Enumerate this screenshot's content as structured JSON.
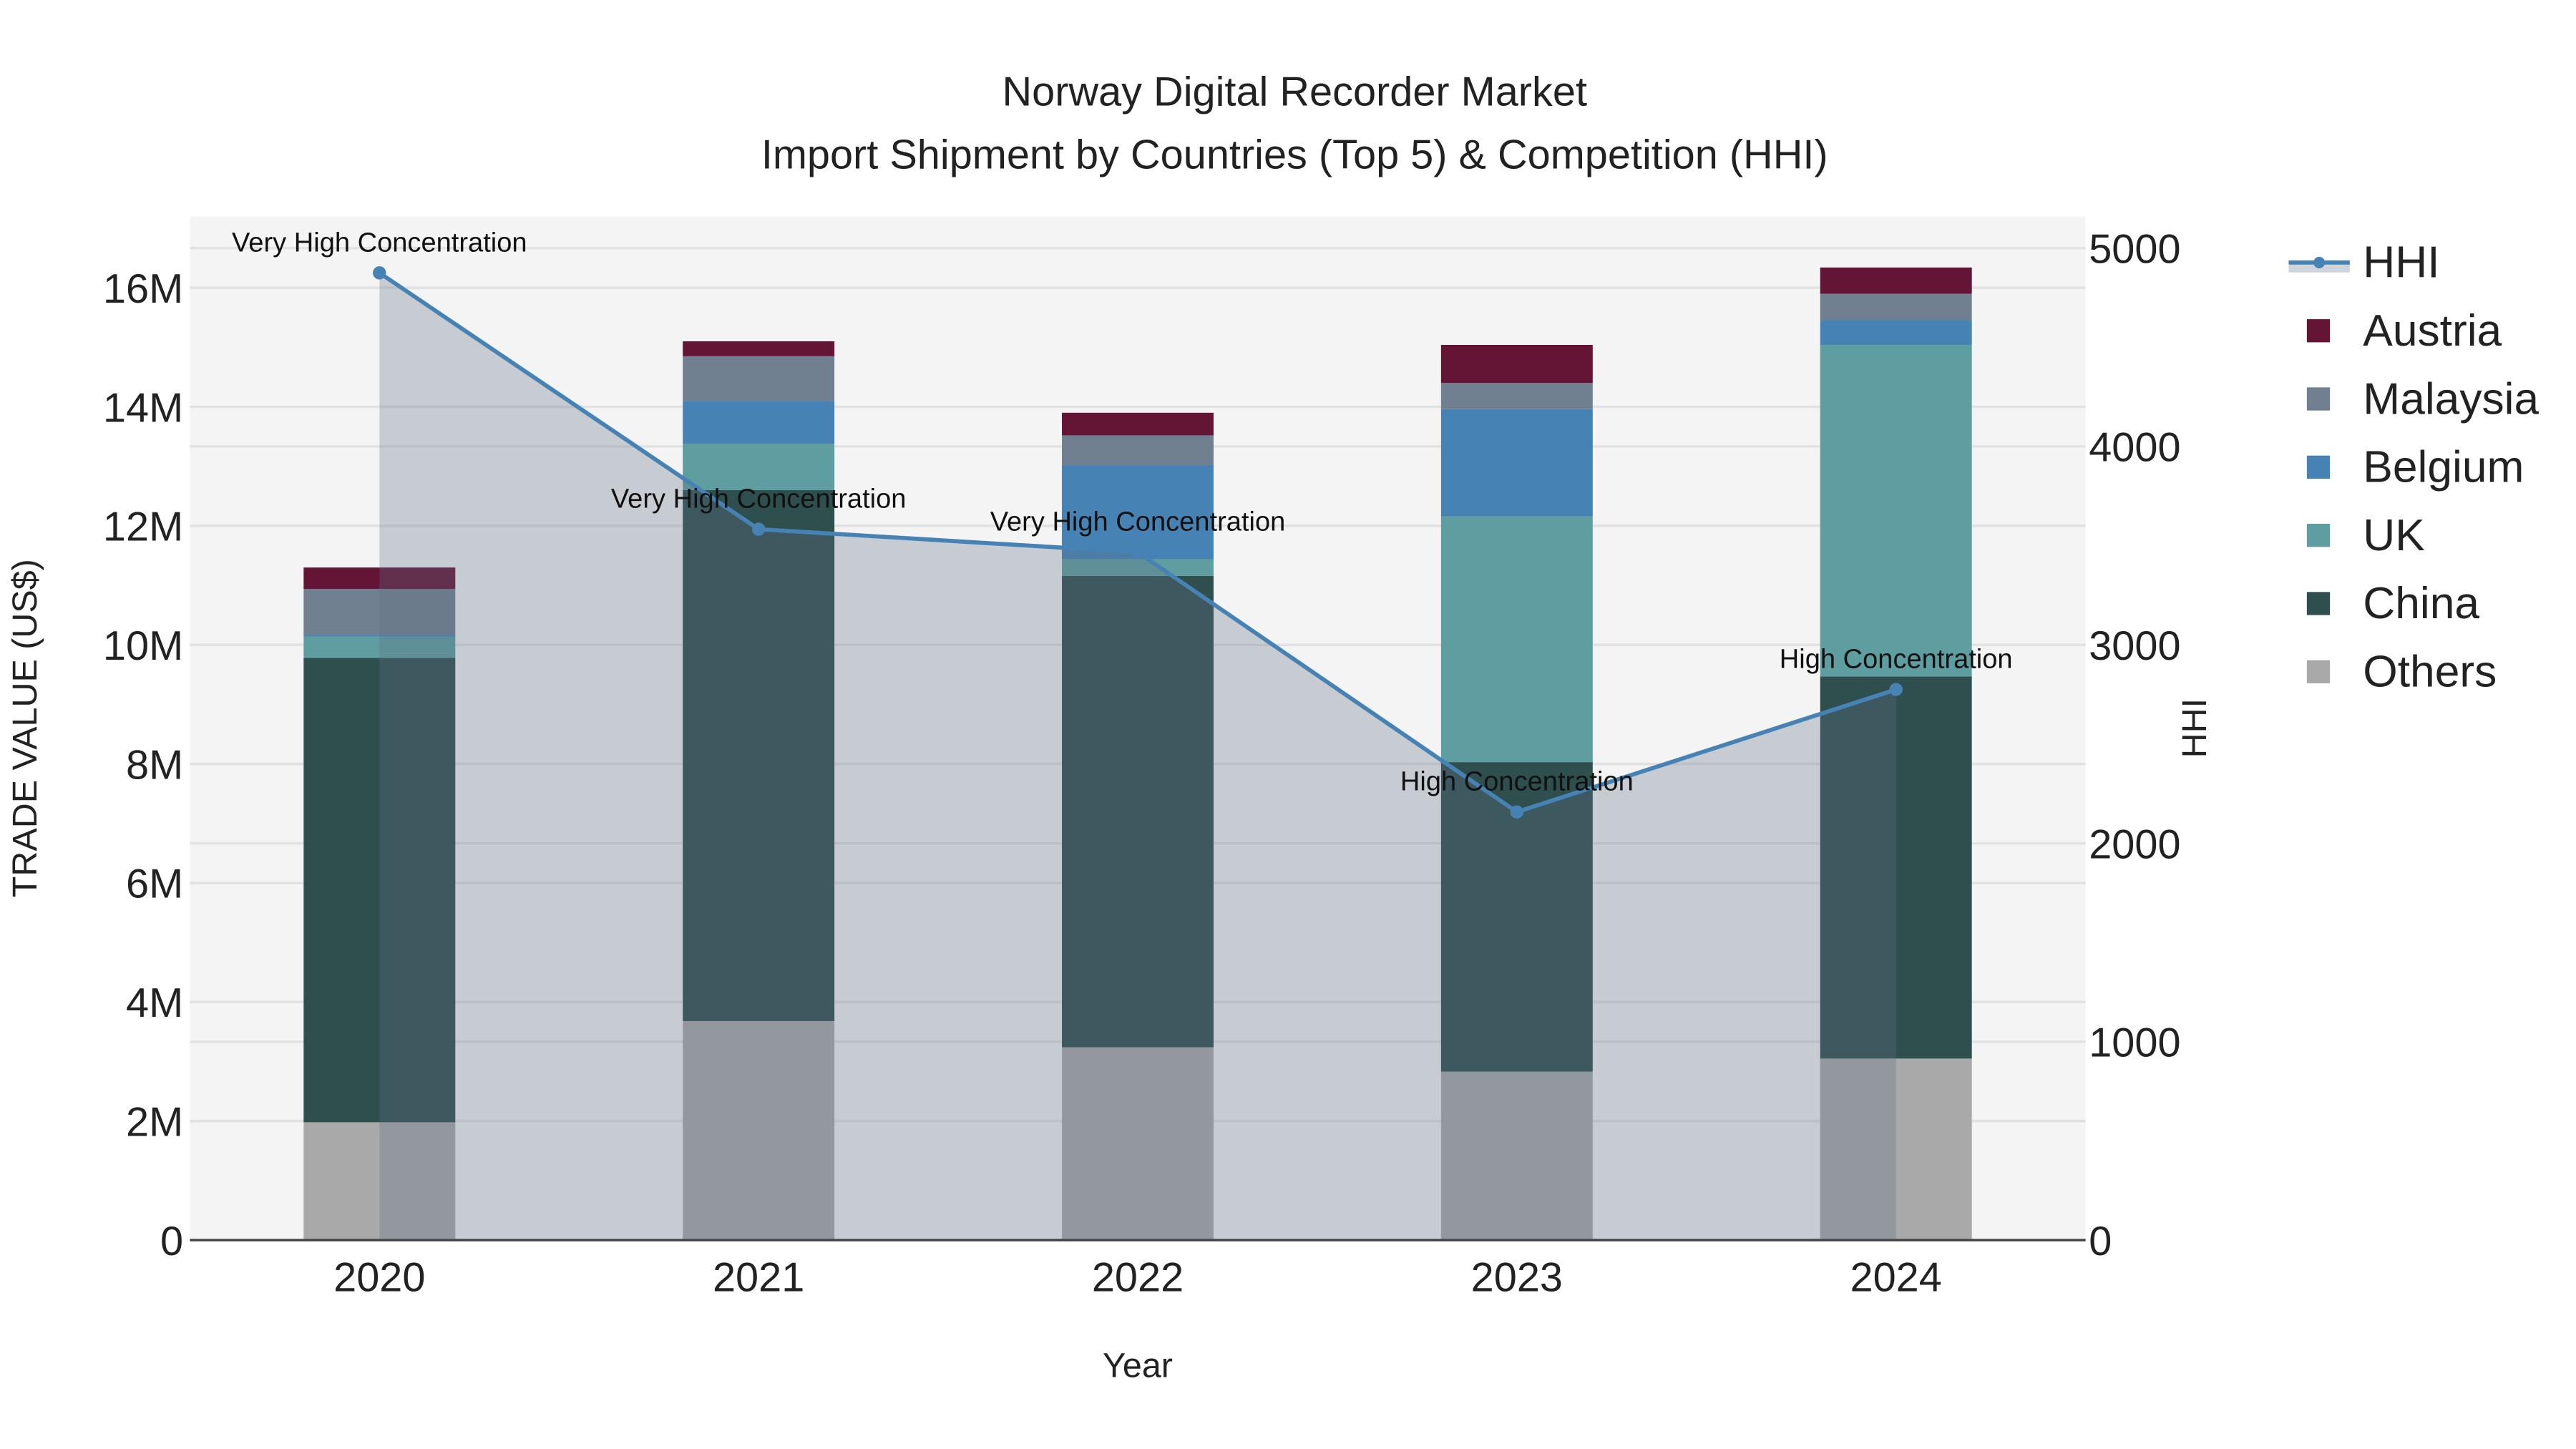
{
  "chart_data": {
    "type": "bar",
    "title_line1": "Norway Digital Recorder Market",
    "title_line2": "Import Shipment by Countries (Top 5) & Competition (HHI)",
    "xlabel": "Year",
    "ylabel": "TRADE VALUE (US$)",
    "y2label": "HHI",
    "categories": [
      "2020",
      "2021",
      "2022",
      "2023",
      "2024"
    ],
    "ylim": [
      0,
      17200000
    ],
    "y2lim": [
      0,
      5160
    ],
    "yticks": [
      {
        "v": 0,
        "label": "0"
      },
      {
        "v": 2000000,
        "label": "2M"
      },
      {
        "v": 4000000,
        "label": "4M"
      },
      {
        "v": 6000000,
        "label": "6M"
      },
      {
        "v": 8000000,
        "label": "8M"
      },
      {
        "v": 10000000,
        "label": "10M"
      },
      {
        "v": 12000000,
        "label": "12M"
      },
      {
        "v": 14000000,
        "label": "14M"
      },
      {
        "v": 16000000,
        "label": "16M"
      }
    ],
    "y2ticks": [
      {
        "v": 0,
        "label": "0"
      },
      {
        "v": 1000,
        "label": "1000"
      },
      {
        "v": 2000,
        "label": "2000"
      },
      {
        "v": 3000,
        "label": "3000"
      },
      {
        "v": 4000,
        "label": "4000"
      },
      {
        "v": 5000,
        "label": "5000"
      }
    ],
    "series": [
      {
        "name": "Others",
        "color": "#a9a9a9",
        "values": [
          1980000,
          3680000,
          3240000,
          2830000,
          3050000
        ]
      },
      {
        "name": "China",
        "color": "#2f4f4f",
        "values": [
          7800000,
          8920000,
          7920000,
          5200000,
          6420000
        ]
      },
      {
        "name": "UK",
        "color": "#5f9ea0",
        "values": [
          360000,
          780000,
          280000,
          4130000,
          5570000
        ]
      },
      {
        "name": "Belgium",
        "color": "#4682b4",
        "values": [
          30000,
          720000,
          1580000,
          1800000,
          420000
        ]
      },
      {
        "name": "Malaysia",
        "color": "#708090",
        "values": [
          770000,
          750000,
          500000,
          440000,
          440000
        ]
      },
      {
        "name": "Austria",
        "color": "#641435",
        "values": [
          360000,
          250000,
          380000,
          640000,
          440000
        ]
      }
    ],
    "hhi": {
      "name": "HHI",
      "color": "#4682b4",
      "values": [
        4875,
        3583,
        3467,
        2158,
        2775
      ],
      "annotations": [
        "Very High Concentration",
        "Very High Concentration",
        "Very High Concentration",
        "High Concentration",
        "High Concentration"
      ]
    },
    "legend_order": [
      "HHI",
      "Austria",
      "Malaysia",
      "Belgium",
      "UK",
      "China",
      "Others"
    ],
    "legend_placement": "right",
    "grid": true
  }
}
